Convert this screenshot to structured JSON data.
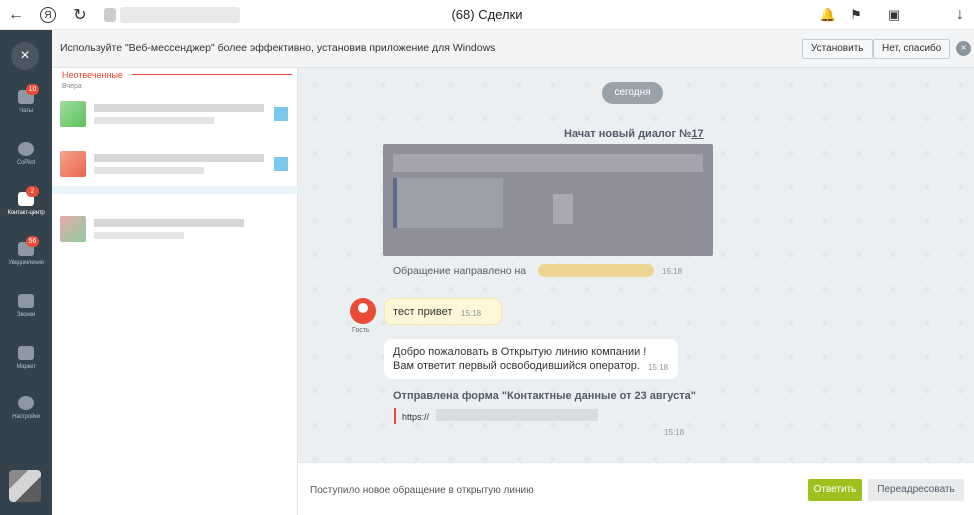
{
  "browser": {
    "tab_title": "(68) Сделки",
    "back_icon": "←",
    "yandex_icon": "Я",
    "reload_icon": "↻",
    "download_icon": "↓"
  },
  "sidebar": {
    "close_icon": "×",
    "items": [
      {
        "label": "Чаты",
        "badge": "10",
        "icon": "chat-icon"
      },
      {
        "label": "CoPilot",
        "badge": "",
        "icon": "copilot-icon"
      },
      {
        "label": "Контакт-центр",
        "badge": "2",
        "icon": "contact-center-icon"
      },
      {
        "label": "Уведомления",
        "badge": "56",
        "icon": "bell-icon"
      },
      {
        "label": "Звонки",
        "badge": "",
        "icon": "phone-icon"
      },
      {
        "label": "Маркет",
        "badge": "",
        "icon": "market-icon"
      },
      {
        "label": "Настройки",
        "badge": "",
        "icon": "gear-icon"
      }
    ]
  },
  "banner": {
    "text": "Используйте \"Веб-мессенджер\" более эффективно, установив приложение для Windows",
    "install_label": "Установить",
    "decline_label": "Нет, спасибо",
    "close_icon": "×"
  },
  "list": {
    "section_title": "Неотвеченные",
    "day_label": "Вчера"
  },
  "chat": {
    "date_pill": "сегодня",
    "new_dialog_prefix": "Начат новый диалог №",
    "new_dialog_number": "17",
    "directed_text": "Обращение направлено на",
    "directed_time": "15:18",
    "guest_label": "Гость",
    "guest_message": "тест привет",
    "guest_time": "15:18",
    "welcome_line1": "Добро пожаловать в Открытую линию компании !",
    "welcome_line2": "Вам ответит первый освободившийся оператор.",
    "welcome_time": "15:18",
    "form_title": "Отправлена форма \"Контактные данные от 23 августа\"",
    "form_url": "https://",
    "form_time": "15:18"
  },
  "bottom": {
    "status_text": "Поступило новое обращение в открытую линию",
    "answer_label": "Ответить",
    "forward_label": "Переадресовать"
  },
  "colors": {
    "sidebar_bg": "#34424e",
    "accent_red": "#e94b35",
    "answer_green": "#9dc21f"
  }
}
